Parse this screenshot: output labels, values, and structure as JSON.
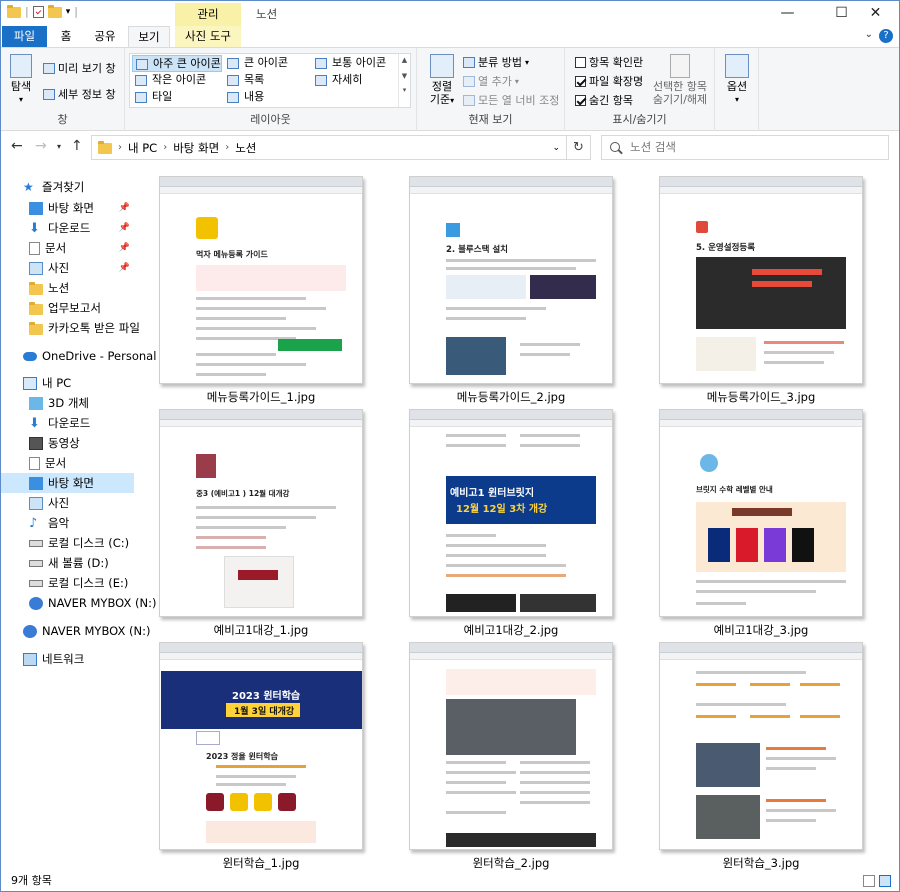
{
  "window": {
    "title": "노션",
    "context_tab": "관리"
  },
  "tabs": {
    "file": "파일",
    "home": "홈",
    "share": "공유",
    "view": "보기",
    "picture_tools": "사진 도구"
  },
  "ribbon": {
    "pane": {
      "nav": "탐색",
      "nav2": "창",
      "preview": "미리 보기 창",
      "details": "세부 정보 창",
      "label": "창"
    },
    "layout": {
      "items": [
        "아주 큰 아이콘",
        "큰 아이콘",
        "보통 아이콘",
        "작은 아이콘",
        "목록",
        "자세히",
        "타일",
        "내용"
      ],
      "selected": "아주 큰 아이콘",
      "label": "레이아웃"
    },
    "current_view": {
      "sort_line1": "정렬",
      "sort_line2": "기준",
      "group_by": "분류 방법",
      "add_columns": "열 추가",
      "fit_columns": "모든 열 너비 조정",
      "label": "현재 보기"
    },
    "show_hide": {
      "item_checkboxes": "항목 확인란",
      "item_checkboxes_checked": false,
      "file_ext": "파일 확장명",
      "file_ext_checked": true,
      "hidden_items": "숨긴 항목",
      "hidden_items_checked": true,
      "hide_selected_line1": "선택한 항목",
      "hide_selected_line2": "숨기기/해제",
      "label": "표시/숨기기"
    },
    "options": "옵션"
  },
  "address": {
    "segments": [
      "내 PC",
      "바탕 화면",
      "노션"
    ]
  },
  "search": {
    "placeholder": "노션 검색"
  },
  "nav_pane": {
    "quick_access": "즐겨찾기",
    "quick_items": [
      "바탕 화면",
      "다운로드",
      "문서",
      "사진",
      "노션",
      "업무보고서",
      "카카오톡 받은 파일"
    ],
    "onedrive": "OneDrive - Personal",
    "this_pc": "내 PC",
    "pc_items": [
      "3D 개체",
      "다운로드",
      "동영상",
      "문서",
      "바탕 화면",
      "사진",
      "음악",
      "로컬 디스크 (C:)",
      "새 볼륨 (D:)",
      "로컬 디스크 (E:)",
      "NAVER MYBOX (N:)"
    ],
    "mybox": "NAVER MYBOX (N:)",
    "network": "네트워크"
  },
  "files": [
    {
      "name": "메뉴등록가이드_1.jpg",
      "heading": "먹자 메뉴등록 가이드"
    },
    {
      "name": "메뉴등록가이드_2.jpg",
      "heading": "2. 블루스택 설치"
    },
    {
      "name": "메뉴등록가이드_3.jpg",
      "heading": "5. 운영설정등록"
    },
    {
      "name": "예비고1대강_1.jpg",
      "heading": "중3 (예비고1 ) 12월 대개강"
    },
    {
      "name": "예비고1대강_2.jpg",
      "heading": "예비고1 윈터브릿지",
      "sub": "12월 12일 3차 개강"
    },
    {
      "name": "예비고1대강_3.jpg",
      "heading": "브릿지 수학 레벨별 안내"
    },
    {
      "name": "윈터학습_1.jpg",
      "heading": "2023 윈터학습",
      "sub": "1월 3일 대개강",
      "sub2": "2023 정율 윈터학습"
    },
    {
      "name": "윈터학습_2.jpg",
      "heading": ""
    },
    {
      "name": "윈터학습_3.jpg",
      "heading": ""
    }
  ],
  "status": {
    "count": "9개 항목"
  },
  "colors": {
    "accent": "#1a6fc7",
    "context": "#f9f1a8",
    "selection": "#cce8ff"
  }
}
